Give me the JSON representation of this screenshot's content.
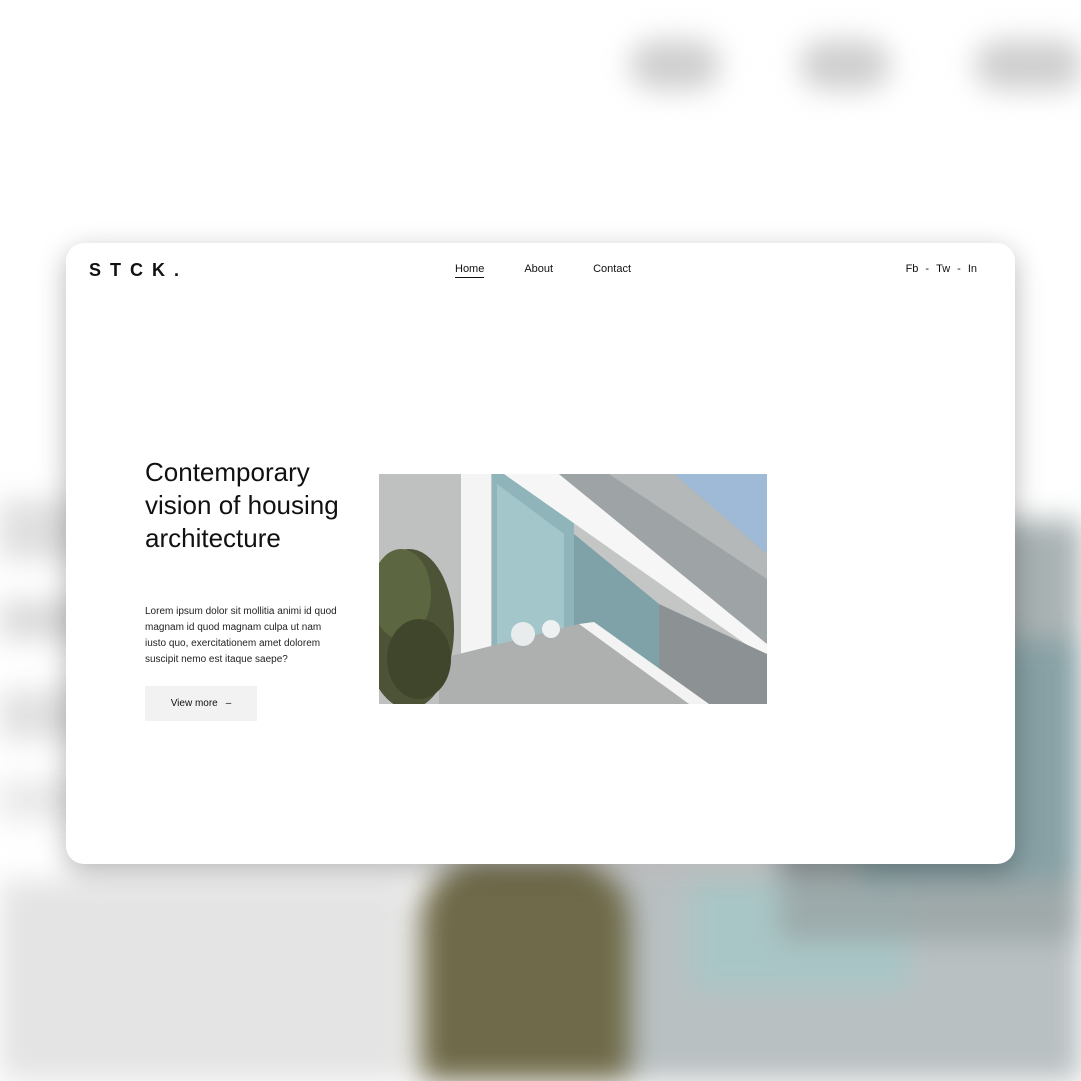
{
  "logo": "STCK.",
  "nav": {
    "items": [
      {
        "label": "Home",
        "active": true
      },
      {
        "label": "About",
        "active": false
      },
      {
        "label": "Contact",
        "active": false
      }
    ]
  },
  "social": {
    "fb": "Fb",
    "tw": "Tw",
    "in": "In",
    "separator": "-"
  },
  "hero": {
    "title": "Contemporary vision of housing architecture",
    "text": "Lorem ipsum dolor sit mollitia animi id quod magnam id quod magnam culpa ut nam iusto quo, exercitationem amet dolorem suscipit nemo est itaque saepe?",
    "button_label": "View more",
    "button_arrow": "–"
  },
  "colors": {
    "text": "#111111",
    "button_bg": "#f2f2f2",
    "card_bg": "#ffffff",
    "sky": "#9ebad6"
  }
}
